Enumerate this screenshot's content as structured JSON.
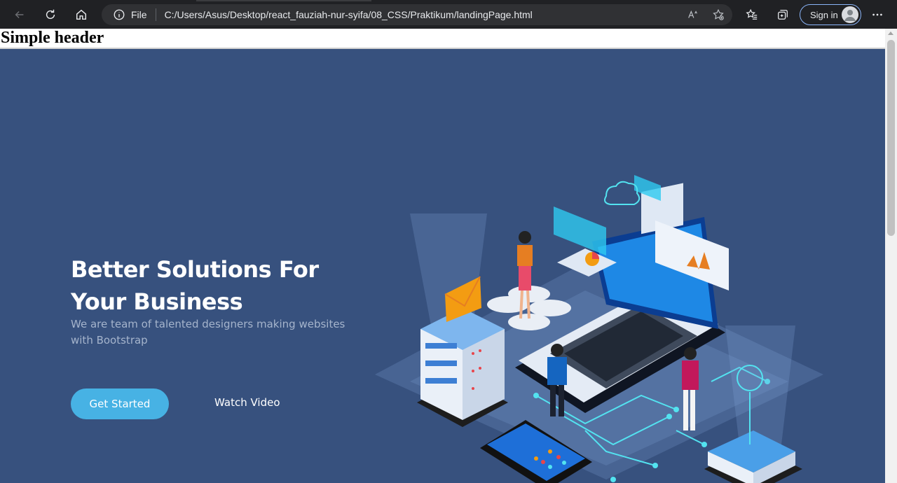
{
  "browser": {
    "address": {
      "scheme_label": "File",
      "url": "C:/Users/Asus/Desktop/react_fauziah-nur-syifa/08_CSS/Praktikum/landingPage.html"
    },
    "signin_label": "Sign in",
    "icons": [
      "back-icon",
      "refresh-icon",
      "home-icon",
      "info-icon",
      "read-aloud-icon",
      "favorite-add-icon",
      "favorites-icon",
      "collections-icon",
      "avatar-icon",
      "more-icon"
    ]
  },
  "page": {
    "header_text": "Simple header",
    "hero": {
      "title": "Better Solutions For Your Business",
      "subtitle": "We are team of talented designers making websites with Bootstrap",
      "primary_button": "Get Started",
      "secondary_button": "Watch Video",
      "background_color": "#37517e",
      "accent_color": "#47b2e4"
    }
  }
}
